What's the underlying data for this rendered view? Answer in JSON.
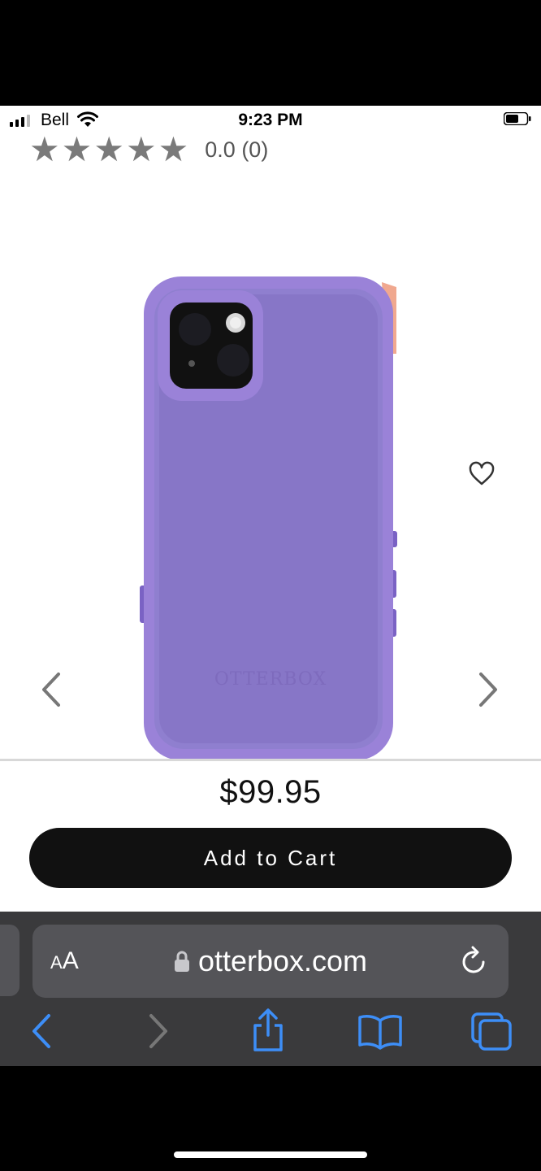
{
  "status_bar": {
    "carrier": "Bell",
    "time": "9:23 PM"
  },
  "product": {
    "rating_text": "0.0 (0)",
    "stars_filled": 0,
    "stars_total": 5,
    "price": "$99.95",
    "add_to_cart_label": "Add to Cart",
    "image_brand_text": "OTTERBOX",
    "case_color": "#8f7fcf",
    "case_edge_color": "#9a82d8"
  },
  "browser": {
    "text_size_label_big": "A",
    "text_size_label_small": "A",
    "url": "otterbox.com"
  },
  "icons": {
    "wishlist": "heart-icon",
    "prev": "chevron-left-icon",
    "next": "chevron-right-icon",
    "reload": "reload-icon",
    "lock": "lock-icon",
    "back": "back-icon",
    "forward": "forward-icon",
    "share": "share-icon",
    "bookmarks": "bookmarks-icon",
    "tabs": "tabs-icon"
  },
  "colors": {
    "accent_blue": "#3d8ef7",
    "toolbar_bg": "#3a3a3c",
    "button_bg": "#111111"
  }
}
